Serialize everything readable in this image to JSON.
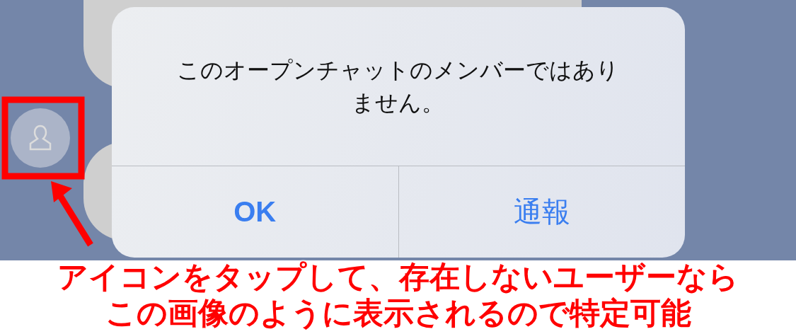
{
  "dialog": {
    "message": "このオープンチャットのメンバーではありません。",
    "buttons": [
      {
        "label": "OK",
        "kind": "primary"
      },
      {
        "label": "通報",
        "kind": "normal"
      }
    ]
  },
  "annotation": {
    "caption": [
      "アイコンをタップして、存在しないユーザーなら",
      "この画像のように表示されるので特定可能"
    ]
  }
}
